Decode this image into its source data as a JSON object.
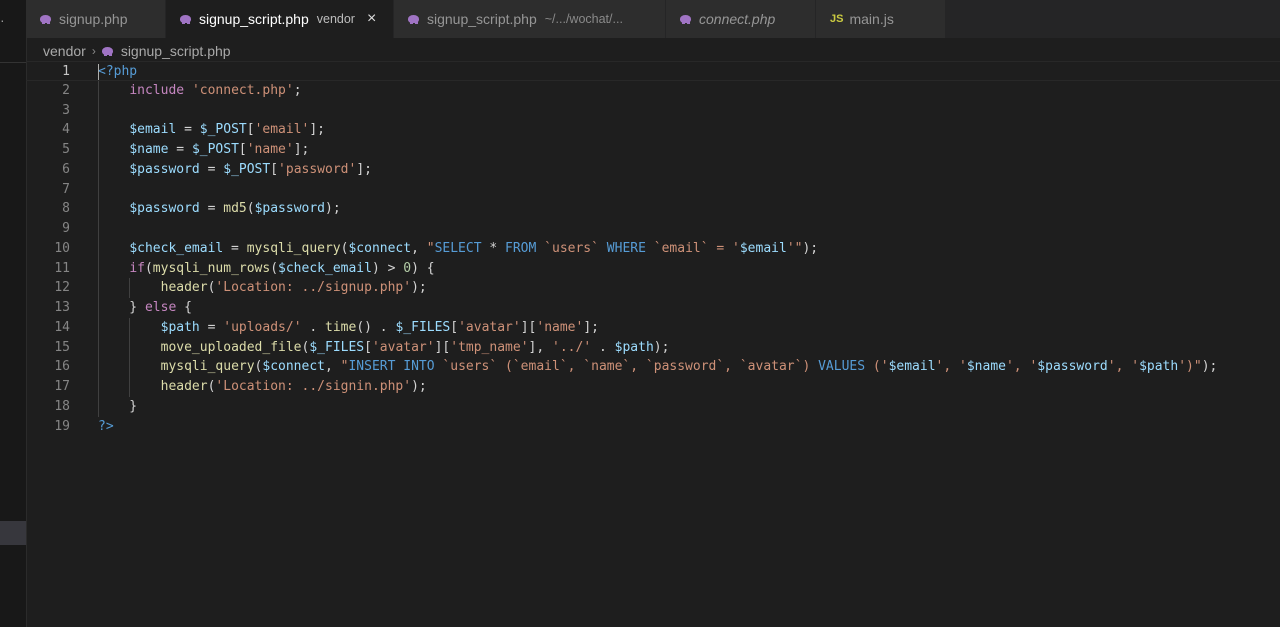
{
  "tabs": [
    {
      "label": "signup.php",
      "icon": "php-icon",
      "desc": "",
      "active": false
    },
    {
      "label": "signup_script.php",
      "icon": "php-icon",
      "desc": "vendor",
      "active": true
    },
    {
      "label": "signup_script.php",
      "icon": "php-icon",
      "desc": "~/.../wochat/...",
      "active": false
    },
    {
      "label": "connect.php",
      "icon": "php-icon",
      "desc": "",
      "active": false
    },
    {
      "label": "main.js",
      "icon": "js-icon",
      "desc": "",
      "active": false
    }
  ],
  "tab_close_glyph": "×",
  "breadcrumb": {
    "folder": "vendor",
    "file": "signup_script.php"
  },
  "activity_glyph": "·",
  "editor": {
    "lines": [
      [
        {
          "t": "<?php",
          "c": "tag"
        }
      ],
      [
        {
          "t": "    "
        },
        {
          "t": "include",
          "c": "kw"
        },
        {
          "t": " "
        },
        {
          "t": "'connect.php'",
          "c": "str"
        },
        {
          "t": ";"
        }
      ],
      [],
      [
        {
          "t": "    "
        },
        {
          "t": "$email",
          "c": "var"
        },
        {
          "t": " = "
        },
        {
          "t": "$_POST",
          "c": "var"
        },
        {
          "t": "["
        },
        {
          "t": "'email'",
          "c": "str"
        },
        {
          "t": "];"
        }
      ],
      [
        {
          "t": "    "
        },
        {
          "t": "$name",
          "c": "var"
        },
        {
          "t": " = "
        },
        {
          "t": "$_POST",
          "c": "var"
        },
        {
          "t": "["
        },
        {
          "t": "'name'",
          "c": "str"
        },
        {
          "t": "];"
        }
      ],
      [
        {
          "t": "    "
        },
        {
          "t": "$password",
          "c": "var"
        },
        {
          "t": " = "
        },
        {
          "t": "$_POST",
          "c": "var"
        },
        {
          "t": "["
        },
        {
          "t": "'password'",
          "c": "str"
        },
        {
          "t": "];"
        }
      ],
      [],
      [
        {
          "t": "    "
        },
        {
          "t": "$password",
          "c": "var"
        },
        {
          "t": " = "
        },
        {
          "t": "md5",
          "c": "fn"
        },
        {
          "t": "("
        },
        {
          "t": "$password",
          "c": "var"
        },
        {
          "t": ");"
        }
      ],
      [],
      [
        {
          "t": "    "
        },
        {
          "t": "$check_email",
          "c": "var"
        },
        {
          "t": " = "
        },
        {
          "t": "mysqli_query",
          "c": "fn"
        },
        {
          "t": "("
        },
        {
          "t": "$connect",
          "c": "var"
        },
        {
          "t": ", "
        },
        {
          "t": "\"",
          "c": "str"
        },
        {
          "t": "SELECT",
          "c": "sql"
        },
        {
          "t": " * ",
          "c": "punc"
        },
        {
          "t": "FROM",
          "c": "sql"
        },
        {
          "t": " `users` ",
          "c": "str"
        },
        {
          "t": "WHERE",
          "c": "sql"
        },
        {
          "t": " `email` = '",
          "c": "str"
        },
        {
          "t": "$email",
          "c": "var"
        },
        {
          "t": "'\"",
          "c": "str"
        },
        {
          "t": ");"
        }
      ],
      [
        {
          "t": "    "
        },
        {
          "t": "if",
          "c": "kw"
        },
        {
          "t": "("
        },
        {
          "t": "mysqli_num_rows",
          "c": "fn"
        },
        {
          "t": "("
        },
        {
          "t": "$check_email",
          "c": "var"
        },
        {
          "t": ") > "
        },
        {
          "t": "0",
          "c": "num"
        },
        {
          "t": ") {"
        }
      ],
      [
        {
          "t": "        "
        },
        {
          "t": "header",
          "c": "fn"
        },
        {
          "t": "("
        },
        {
          "t": "'Location: ../signup.php'",
          "c": "str"
        },
        {
          "t": ");"
        }
      ],
      [
        {
          "t": "    } "
        },
        {
          "t": "else",
          "c": "kw"
        },
        {
          "t": " {"
        }
      ],
      [
        {
          "t": "        "
        },
        {
          "t": "$path",
          "c": "var"
        },
        {
          "t": " = "
        },
        {
          "t": "'uploads/'",
          "c": "str"
        },
        {
          "t": " . "
        },
        {
          "t": "time",
          "c": "fn"
        },
        {
          "t": "() . "
        },
        {
          "t": "$_FILES",
          "c": "var"
        },
        {
          "t": "["
        },
        {
          "t": "'avatar'",
          "c": "str"
        },
        {
          "t": "]["
        },
        {
          "t": "'name'",
          "c": "str"
        },
        {
          "t": "];"
        }
      ],
      [
        {
          "t": "        "
        },
        {
          "t": "move_uploaded_file",
          "c": "fn"
        },
        {
          "t": "("
        },
        {
          "t": "$_FILES",
          "c": "var"
        },
        {
          "t": "["
        },
        {
          "t": "'avatar'",
          "c": "str"
        },
        {
          "t": "]["
        },
        {
          "t": "'tmp_name'",
          "c": "str"
        },
        {
          "t": "], "
        },
        {
          "t": "'../'",
          "c": "str"
        },
        {
          "t": " . "
        },
        {
          "t": "$path",
          "c": "var"
        },
        {
          "t": ");"
        }
      ],
      [
        {
          "t": "        "
        },
        {
          "t": "mysqli_query",
          "c": "fn"
        },
        {
          "t": "("
        },
        {
          "t": "$connect",
          "c": "var"
        },
        {
          "t": ", "
        },
        {
          "t": "\"",
          "c": "str"
        },
        {
          "t": "INSERT",
          "c": "sql"
        },
        {
          "t": " ",
          "c": "str"
        },
        {
          "t": "INTO",
          "c": "sql"
        },
        {
          "t": " `users` (`email`, `name`, `password`, `avatar`) ",
          "c": "str"
        },
        {
          "t": "VALUES",
          "c": "sql"
        },
        {
          "t": " ('",
          "c": "str"
        },
        {
          "t": "$email",
          "c": "var"
        },
        {
          "t": "', '",
          "c": "str"
        },
        {
          "t": "$name",
          "c": "var"
        },
        {
          "t": "', '",
          "c": "str"
        },
        {
          "t": "$password",
          "c": "var"
        },
        {
          "t": "', '",
          "c": "str"
        },
        {
          "t": "$path",
          "c": "var"
        },
        {
          "t": "')\"",
          "c": "str"
        },
        {
          "t": ");"
        }
      ],
      [
        {
          "t": "        "
        },
        {
          "t": "header",
          "c": "fn"
        },
        {
          "t": "("
        },
        {
          "t": "'Location: ../signin.php'",
          "c": "str"
        },
        {
          "t": ");"
        }
      ],
      [
        {
          "t": "    }"
        }
      ],
      [
        {
          "t": "?>",
          "c": "tag"
        }
      ]
    ]
  }
}
